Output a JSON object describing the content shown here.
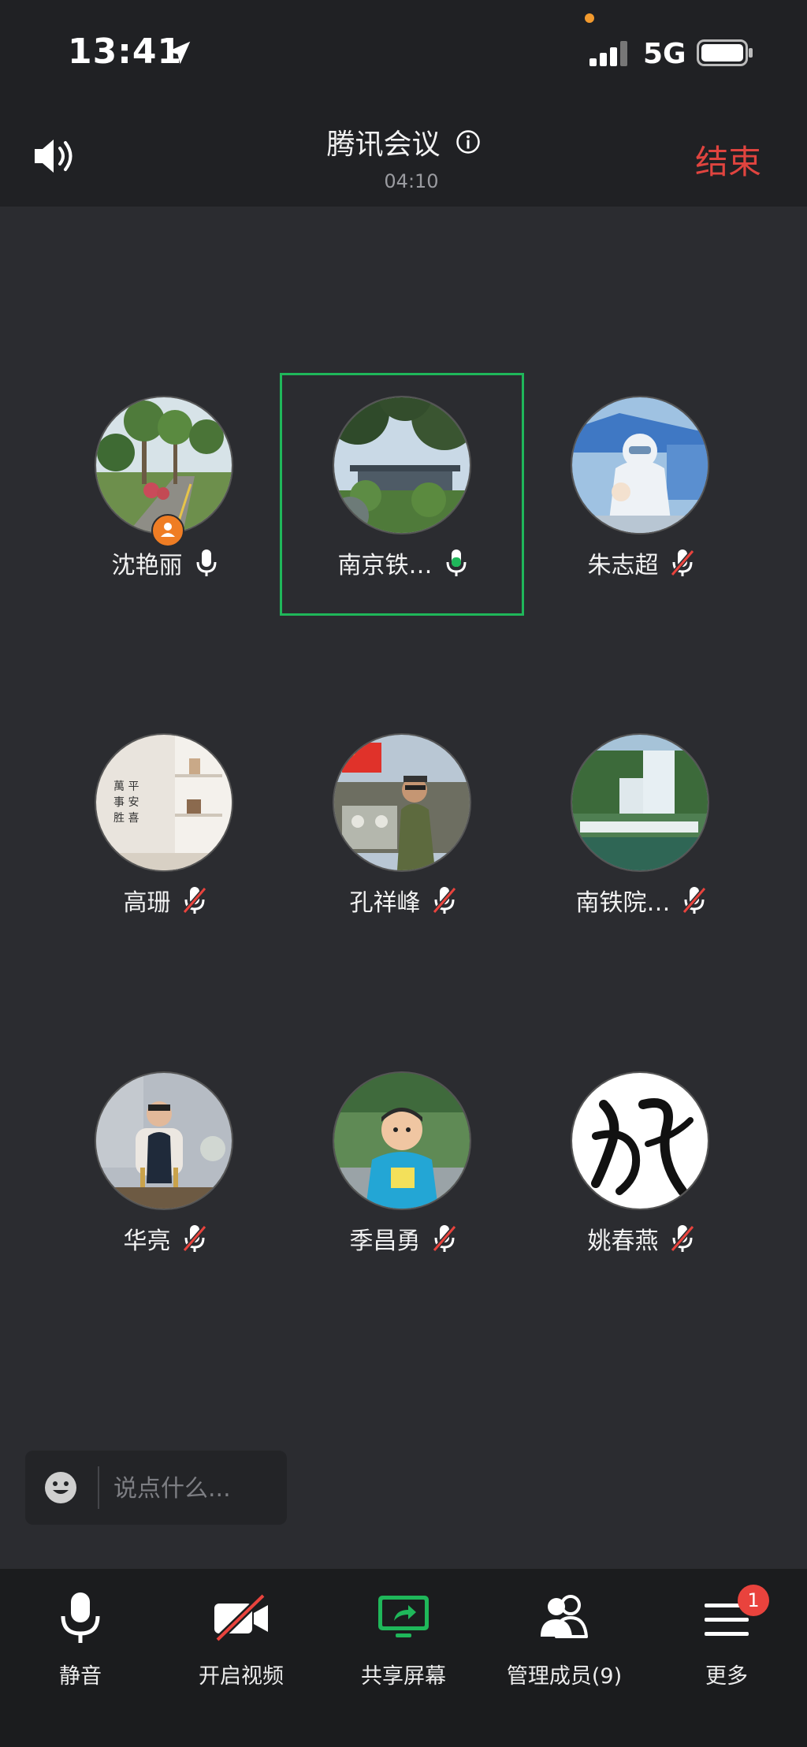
{
  "status_bar": {
    "time": "13:41",
    "network": "5G",
    "location_icon": "location-arrow-icon",
    "signal_icon": "cellular-signal-icon",
    "battery_icon": "battery-icon"
  },
  "header": {
    "title": "腾讯会议",
    "duration": "04:10",
    "end_label": "结束",
    "end_color": "#e0443f"
  },
  "participants": [
    {
      "name": "沈艳丽",
      "mic": "on",
      "host": true,
      "avatar": "palm-trees"
    },
    {
      "name": "南京铁…",
      "mic": "speaking",
      "active": true,
      "avatar": "trees-building"
    },
    {
      "name": "朱志超",
      "mic": "muted",
      "avatar": "medic-ppe"
    },
    {
      "name": "高珊",
      "mic": "muted",
      "avatar": "room-shelf"
    },
    {
      "name": "孔祥峰",
      "mic": "muted",
      "avatar": "man-jeep-flag"
    },
    {
      "name": "南铁院…",
      "mic": "muted",
      "avatar": "waterfall"
    },
    {
      "name": "华亮",
      "mic": "muted",
      "avatar": "child-chair"
    },
    {
      "name": "季昌勇",
      "mic": "muted",
      "avatar": "child-blue-shirt"
    },
    {
      "name": "姚春燕",
      "mic": "muted",
      "avatar": "calligraphy"
    }
  ],
  "chat": {
    "placeholder": "说点什么..."
  },
  "toolbar": {
    "mute_label": "静音",
    "video_label": "开启视频",
    "share_label": "共享屏幕",
    "members_label": "管理成员(9)",
    "more_label": "更多",
    "more_badge": "1",
    "accent_green": "#1fb75a",
    "badge_color": "#e9433d"
  }
}
